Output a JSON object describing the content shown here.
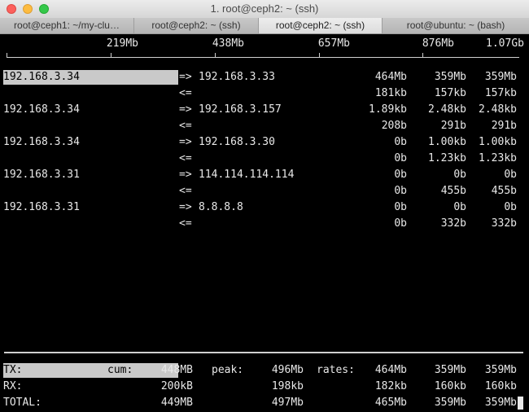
{
  "window": {
    "title": "1. root@ceph2: ~ (ssh)"
  },
  "tabs": [
    {
      "label": "root@ceph1: ~/my-clu…"
    },
    {
      "label": "root@ceph2: ~ (ssh)"
    },
    {
      "label": "root@ceph2: ~ (ssh)",
      "active": true
    },
    {
      "label": "root@ubuntu: ~ (bash)"
    }
  ],
  "scale": [
    "219Mb",
    "438Mb",
    "657Mb",
    "876Mb",
    "1.07Gb"
  ],
  "flows": [
    {
      "src": "192.168.3.34",
      "dst": "192.168.3.33",
      "out_arrow": "=>",
      "in_arrow": "<=",
      "out": [
        "464Mb",
        "359Mb",
        "359Mb"
      ],
      "in": [
        "181kb",
        "157kb",
        "157kb"
      ]
    },
    {
      "src": "192.168.3.34",
      "dst": "192.168.3.157",
      "out_arrow": "=>",
      "in_arrow": "<=",
      "out": [
        "1.89kb",
        "2.48kb",
        "2.48kb"
      ],
      "in": [
        "208b",
        "291b",
        "291b"
      ]
    },
    {
      "src": "192.168.3.34",
      "dst": "192.168.3.30",
      "out_arrow": "=>",
      "in_arrow": "<=",
      "out": [
        "0b",
        "1.00kb",
        "1.00kb"
      ],
      "in": [
        "0b",
        "1.23kb",
        "1.23kb"
      ]
    },
    {
      "src": "192.168.3.31",
      "dst": "114.114.114.114",
      "out_arrow": "=>",
      "in_arrow": "<=",
      "out": [
        "0b",
        "0b",
        "0b"
      ],
      "in": [
        "0b",
        "455b",
        "455b"
      ]
    },
    {
      "src": "192.168.3.31",
      "dst": "8.8.8.8",
      "out_arrow": "=>",
      "in_arrow": "<=",
      "out": [
        "0b",
        "0b",
        "0b"
      ],
      "in": [
        "0b",
        "332b",
        "332b"
      ]
    }
  ],
  "totals": {
    "cum_label": "cum:",
    "peak_label": "peak:",
    "rates_label": "rates:",
    "rows": [
      {
        "label": "TX:",
        "cum": "448MB",
        "peak": "496Mb",
        "rates": [
          "464Mb",
          "359Mb",
          "359Mb"
        ]
      },
      {
        "label": "RX:",
        "cum": "200kB",
        "peak": "198kb",
        "rates": [
          "182kb",
          "160kb",
          "160kb"
        ]
      },
      {
        "label": "TOTAL:",
        "cum": "449MB",
        "peak": "497Mb",
        "rates": [
          "465Mb",
          "359Mb",
          "359Mb"
        ]
      }
    ]
  },
  "colors": {
    "background": "#000000",
    "text": "#e8e8e8",
    "highlight": "#c9c9c9"
  }
}
